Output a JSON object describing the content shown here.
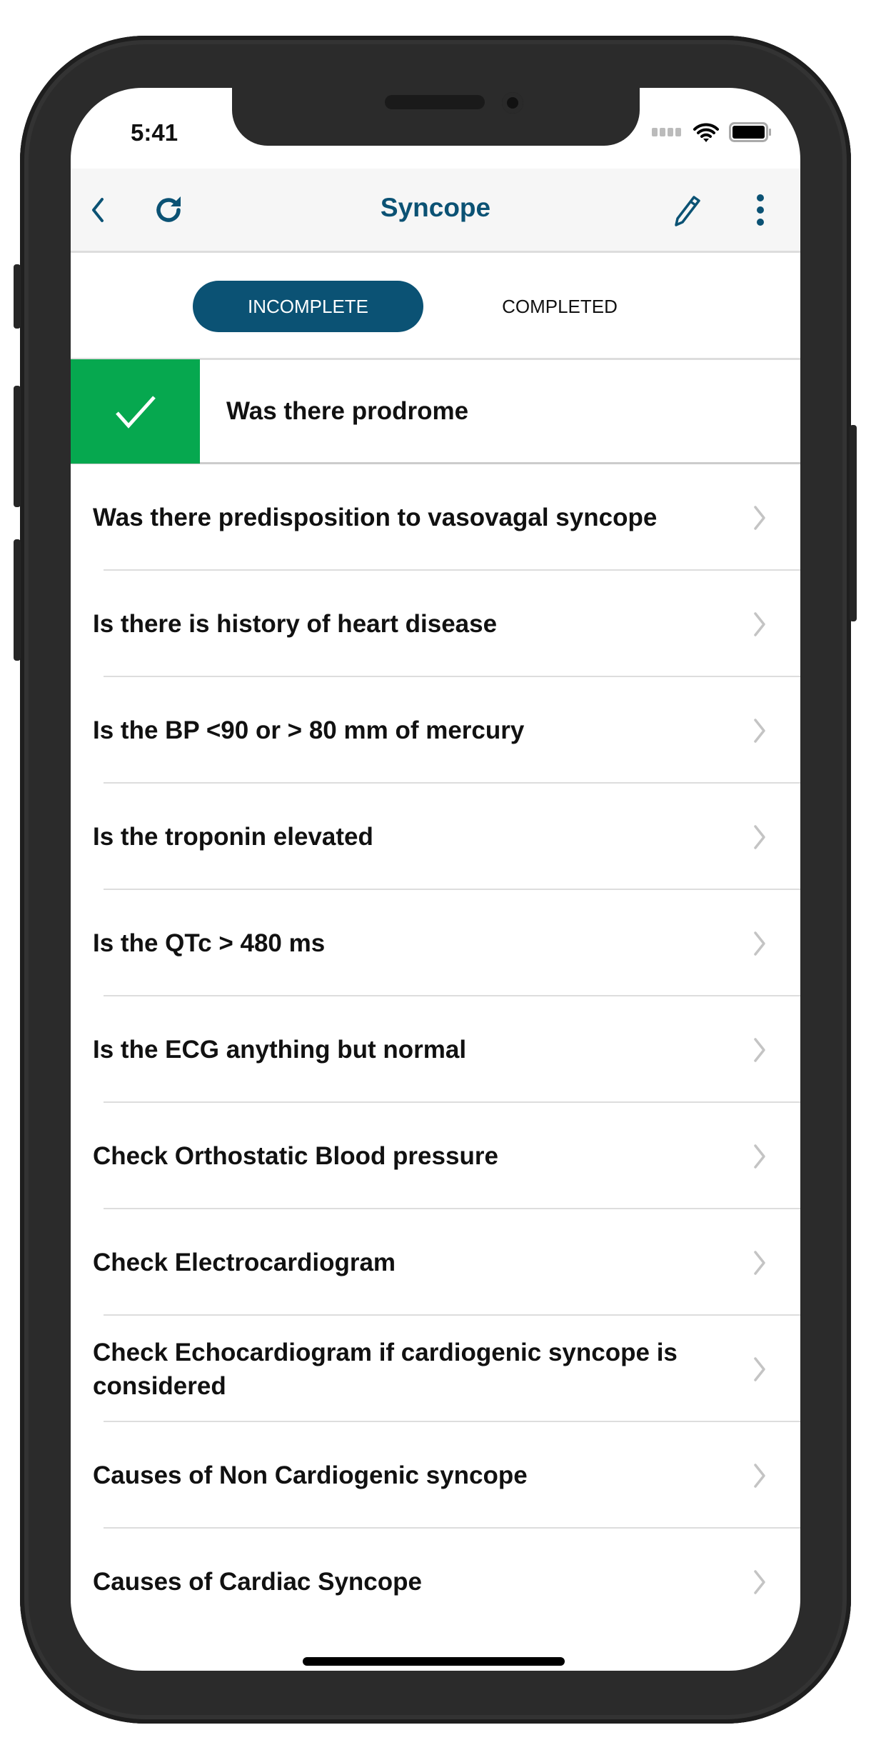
{
  "status_bar": {
    "time": "5:41"
  },
  "header": {
    "title": "Syncope",
    "back_icon": "chevron-left-icon",
    "refresh_icon": "refresh-icon",
    "edit_icon": "pencil-icon",
    "more_icon": "more-vertical-icon"
  },
  "tabs": [
    {
      "label": "INCOMPLETE",
      "active": true
    },
    {
      "label": "COMPLETED",
      "active": false
    }
  ],
  "colors": {
    "accent": "#0b5274",
    "completed": "#06a84f"
  },
  "completed_item": {
    "label": "Was there prodrome"
  },
  "items": [
    {
      "label": "Was there predisposition to vasovagal syncope"
    },
    {
      "label": "Is there is history of heart disease"
    },
    {
      "label": "Is the BP <90 or > 80 mm of mercury"
    },
    {
      "label": "Is the troponin elevated"
    },
    {
      "label": "Is the QTc > 480 ms"
    },
    {
      "label": "Is the ECG anything but normal"
    },
    {
      "label": "Check Orthostatic Blood pressure"
    },
    {
      "label": "Check Electrocardiogram"
    },
    {
      "label": "Check Echocardiogram if cardiogenic syncope is considered"
    },
    {
      "label": "Causes of Non Cardiogenic syncope"
    },
    {
      "label": "Causes of Cardiac Syncope"
    }
  ]
}
